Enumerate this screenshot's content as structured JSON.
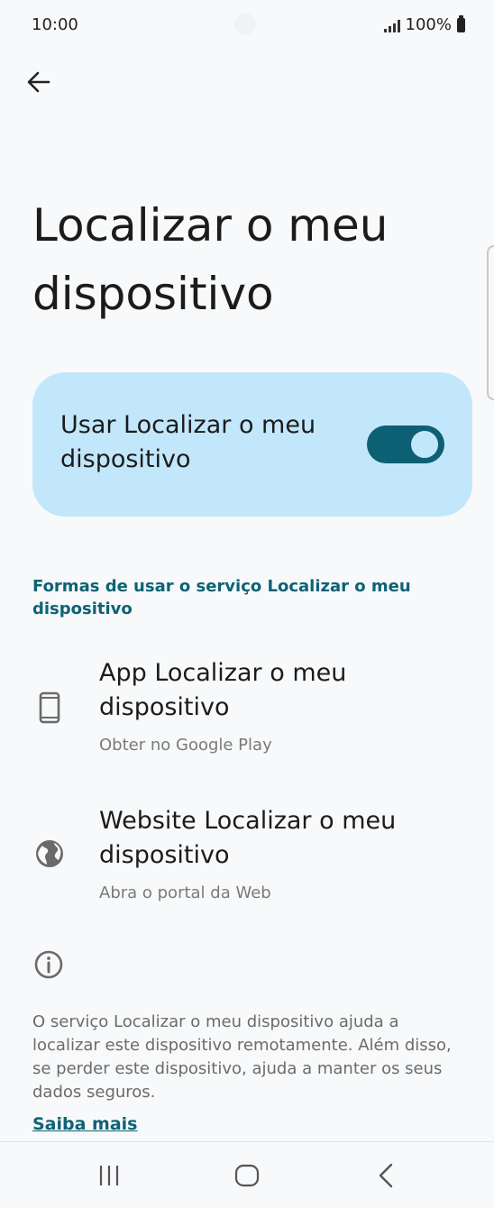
{
  "status_bar": {
    "time": "10:00",
    "battery": "100%"
  },
  "header": {
    "title": "Localizar o meu dispositivo"
  },
  "toggle": {
    "label": "Usar Localizar o meu dispositivo",
    "state": "on"
  },
  "section": {
    "header": "Formas de usar o serviço Localizar o meu dispositivo"
  },
  "items": [
    {
      "title": "App Localizar o meu dispositivo",
      "subtitle": "Obter no Google Play",
      "icon": "phone-icon"
    },
    {
      "title": "Website Localizar o meu dispositivo",
      "subtitle": "Abra o portal da Web",
      "icon": "globe-icon"
    }
  ],
  "info": {
    "text": "O serviço Localizar o meu dispositivo ajuda a localizar este dispositivo remotamente. Além disso, se perder este dispositivo, ajuda a manter os seus dados seguros.",
    "link": "Saiba mais"
  },
  "colors": {
    "accent": "#0d6375",
    "card": "#c2e7fb",
    "switch_track": "#0d6073"
  }
}
